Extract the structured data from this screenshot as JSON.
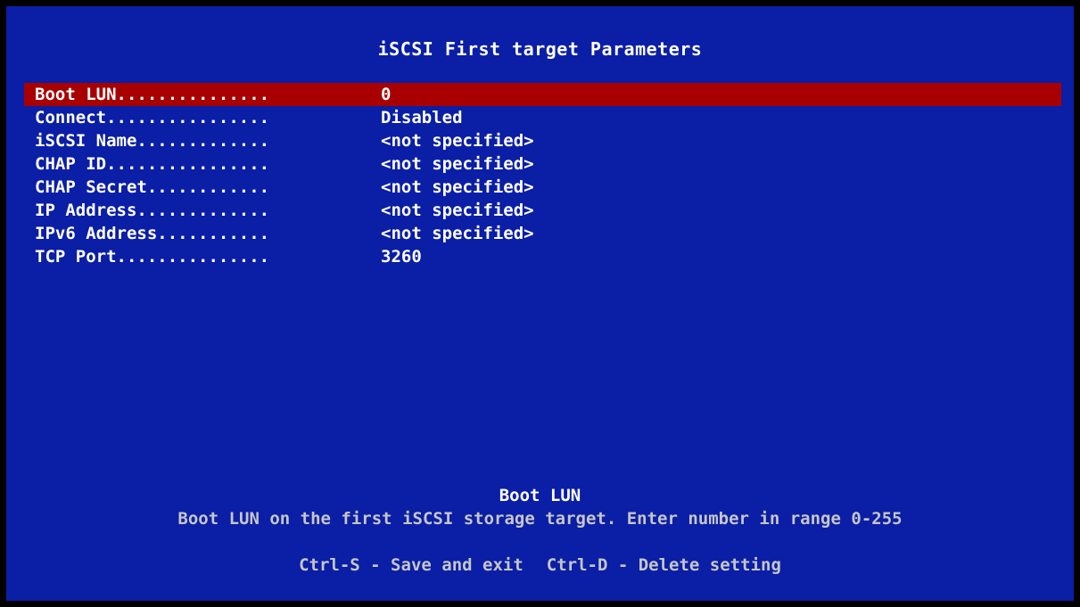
{
  "title": "iSCSI First target Parameters",
  "menu": {
    "items": [
      {
        "label": "Boot LUN...............",
        "value": "0",
        "selected": true
      },
      {
        "label": "Connect................",
        "value": "Disabled",
        "selected": false
      },
      {
        "label": "iSCSI Name.............",
        "value": "<not specified>",
        "selected": false
      },
      {
        "label": "CHAP ID................",
        "value": "<not specified>",
        "selected": false
      },
      {
        "label": "CHAP Secret............",
        "value": "<not specified>",
        "selected": false
      },
      {
        "label": "IP Address.............",
        "value": "<not specified>",
        "selected": false
      },
      {
        "label": "IPv6 Address...........",
        "value": "<not specified>",
        "selected": false
      },
      {
        "label": "TCP Port...............",
        "value": "3260",
        "selected": false
      }
    ]
  },
  "help": {
    "title": "Boot LUN",
    "text": "Boot LUN on the first iSCSI storage target. Enter number in range 0-255"
  },
  "keys": {
    "save": "Ctrl-S - Save and exit",
    "delete": "Ctrl-D - Delete setting"
  },
  "colors": {
    "background": "#0A1EA6",
    "selection": "#A80000",
    "text": "#FFFFFF",
    "dim_text": "#C6C6C6",
    "border": "#000000"
  }
}
